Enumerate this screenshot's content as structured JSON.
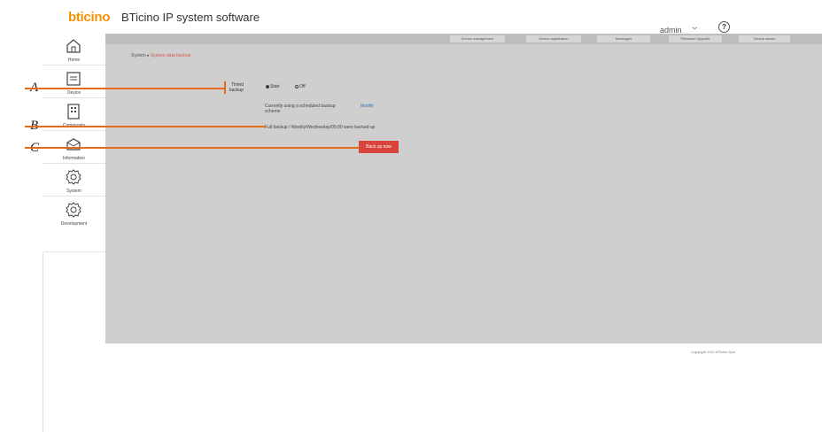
{
  "header": {
    "logo_text": "bticino",
    "app_title": "BTicino IP system software",
    "user": "admin",
    "help_glyph": "?"
  },
  "topnav": [
    {
      "label": "Device management"
    },
    {
      "label": "Device registration"
    },
    {
      "label": "Messages"
    },
    {
      "label": "Firmware Upgrade"
    },
    {
      "label": "Device status"
    }
  ],
  "sidebar": {
    "items": [
      {
        "label": "Home",
        "icon": "home-icon"
      },
      {
        "label": "Device",
        "icon": "device-icon"
      },
      {
        "label": "Community",
        "icon": "community-icon"
      },
      {
        "label": "Information",
        "icon": "information-icon"
      },
      {
        "label": "System",
        "icon": "gear-icon"
      },
      {
        "label": "Development",
        "icon": "gear-icon"
      }
    ]
  },
  "breadcrumb": {
    "parent": "System",
    "current": "System data backup"
  },
  "backup": {
    "timed_label_line1": "Timed",
    "timed_label_line2": "backup",
    "option_start": "Start",
    "option_off": "Off",
    "selected": "Start",
    "schedule_line1": "Currently using a scheduled backup",
    "schedule_line2": "scheme",
    "modify_label": "Modify",
    "last_backup": "Full backup / Weekly/Wednesday/05:00 were backed up",
    "button_label": "Back up now"
  },
  "footer": {
    "copyright": "Copyright 2021 BTicino SpA"
  },
  "callouts": [
    "A",
    "B",
    "C"
  ],
  "colors": {
    "accent_button": "#d9453c",
    "callout_line": "#e36c1a",
    "main_bg": "#cfcfcf",
    "link": "#3b6fb6"
  }
}
